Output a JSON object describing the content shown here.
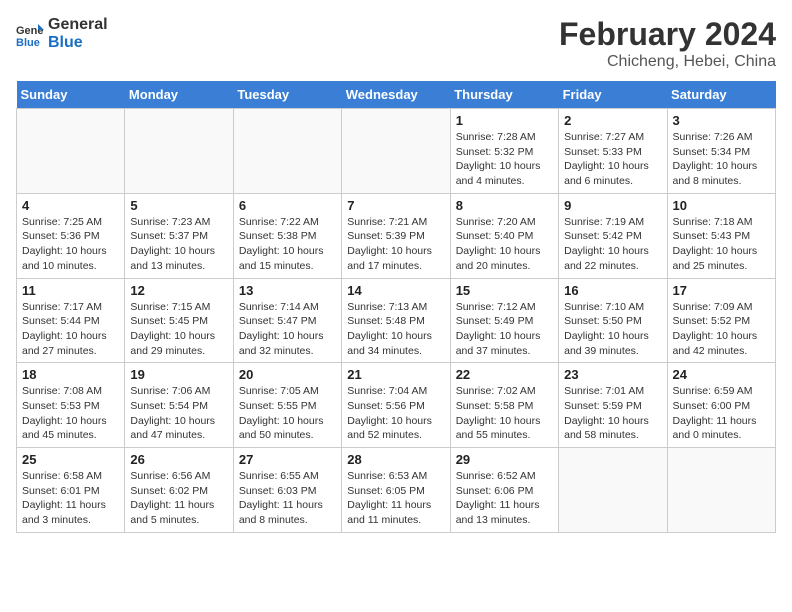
{
  "header": {
    "logo_line1": "General",
    "logo_line2": "Blue",
    "month_title": "February 2024",
    "location": "Chicheng, Hebei, China"
  },
  "weekdays": [
    "Sunday",
    "Monday",
    "Tuesday",
    "Wednesday",
    "Thursday",
    "Friday",
    "Saturday"
  ],
  "weeks": [
    [
      {
        "day": "",
        "info": ""
      },
      {
        "day": "",
        "info": ""
      },
      {
        "day": "",
        "info": ""
      },
      {
        "day": "",
        "info": ""
      },
      {
        "day": "1",
        "info": "Sunrise: 7:28 AM\nSunset: 5:32 PM\nDaylight: 10 hours\nand 4 minutes."
      },
      {
        "day": "2",
        "info": "Sunrise: 7:27 AM\nSunset: 5:33 PM\nDaylight: 10 hours\nand 6 minutes."
      },
      {
        "day": "3",
        "info": "Sunrise: 7:26 AM\nSunset: 5:34 PM\nDaylight: 10 hours\nand 8 minutes."
      }
    ],
    [
      {
        "day": "4",
        "info": "Sunrise: 7:25 AM\nSunset: 5:36 PM\nDaylight: 10 hours\nand 10 minutes."
      },
      {
        "day": "5",
        "info": "Sunrise: 7:23 AM\nSunset: 5:37 PM\nDaylight: 10 hours\nand 13 minutes."
      },
      {
        "day": "6",
        "info": "Sunrise: 7:22 AM\nSunset: 5:38 PM\nDaylight: 10 hours\nand 15 minutes."
      },
      {
        "day": "7",
        "info": "Sunrise: 7:21 AM\nSunset: 5:39 PM\nDaylight: 10 hours\nand 17 minutes."
      },
      {
        "day": "8",
        "info": "Sunrise: 7:20 AM\nSunset: 5:40 PM\nDaylight: 10 hours\nand 20 minutes."
      },
      {
        "day": "9",
        "info": "Sunrise: 7:19 AM\nSunset: 5:42 PM\nDaylight: 10 hours\nand 22 minutes."
      },
      {
        "day": "10",
        "info": "Sunrise: 7:18 AM\nSunset: 5:43 PM\nDaylight: 10 hours\nand 25 minutes."
      }
    ],
    [
      {
        "day": "11",
        "info": "Sunrise: 7:17 AM\nSunset: 5:44 PM\nDaylight: 10 hours\nand 27 minutes."
      },
      {
        "day": "12",
        "info": "Sunrise: 7:15 AM\nSunset: 5:45 PM\nDaylight: 10 hours\nand 29 minutes."
      },
      {
        "day": "13",
        "info": "Sunrise: 7:14 AM\nSunset: 5:47 PM\nDaylight: 10 hours\nand 32 minutes."
      },
      {
        "day": "14",
        "info": "Sunrise: 7:13 AM\nSunset: 5:48 PM\nDaylight: 10 hours\nand 34 minutes."
      },
      {
        "day": "15",
        "info": "Sunrise: 7:12 AM\nSunset: 5:49 PM\nDaylight: 10 hours\nand 37 minutes."
      },
      {
        "day": "16",
        "info": "Sunrise: 7:10 AM\nSunset: 5:50 PM\nDaylight: 10 hours\nand 39 minutes."
      },
      {
        "day": "17",
        "info": "Sunrise: 7:09 AM\nSunset: 5:52 PM\nDaylight: 10 hours\nand 42 minutes."
      }
    ],
    [
      {
        "day": "18",
        "info": "Sunrise: 7:08 AM\nSunset: 5:53 PM\nDaylight: 10 hours\nand 45 minutes."
      },
      {
        "day": "19",
        "info": "Sunrise: 7:06 AM\nSunset: 5:54 PM\nDaylight: 10 hours\nand 47 minutes."
      },
      {
        "day": "20",
        "info": "Sunrise: 7:05 AM\nSunset: 5:55 PM\nDaylight: 10 hours\nand 50 minutes."
      },
      {
        "day": "21",
        "info": "Sunrise: 7:04 AM\nSunset: 5:56 PM\nDaylight: 10 hours\nand 52 minutes."
      },
      {
        "day": "22",
        "info": "Sunrise: 7:02 AM\nSunset: 5:58 PM\nDaylight: 10 hours\nand 55 minutes."
      },
      {
        "day": "23",
        "info": "Sunrise: 7:01 AM\nSunset: 5:59 PM\nDaylight: 10 hours\nand 58 minutes."
      },
      {
        "day": "24",
        "info": "Sunrise: 6:59 AM\nSunset: 6:00 PM\nDaylight: 11 hours\nand 0 minutes."
      }
    ],
    [
      {
        "day": "25",
        "info": "Sunrise: 6:58 AM\nSunset: 6:01 PM\nDaylight: 11 hours\nand 3 minutes."
      },
      {
        "day": "26",
        "info": "Sunrise: 6:56 AM\nSunset: 6:02 PM\nDaylight: 11 hours\nand 5 minutes."
      },
      {
        "day": "27",
        "info": "Sunrise: 6:55 AM\nSunset: 6:03 PM\nDaylight: 11 hours\nand 8 minutes."
      },
      {
        "day": "28",
        "info": "Sunrise: 6:53 AM\nSunset: 6:05 PM\nDaylight: 11 hours\nand 11 minutes."
      },
      {
        "day": "29",
        "info": "Sunrise: 6:52 AM\nSunset: 6:06 PM\nDaylight: 11 hours\nand 13 minutes."
      },
      {
        "day": "",
        "info": ""
      },
      {
        "day": "",
        "info": ""
      }
    ]
  ]
}
